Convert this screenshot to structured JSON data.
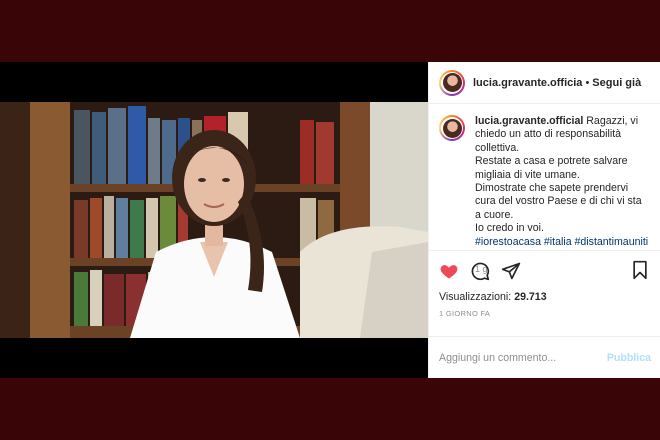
{
  "header": {
    "username": "lucia.gravante.officia",
    "separator": "•",
    "follow_status": "Segui già"
  },
  "caption": {
    "username": "lucia.gravante.official",
    "text_lines": [
      " Ragazzi, vi chiedo un atto di responsabilità collettiva.",
      "Restate a casa e potrete salvare migliaia di vite umane.",
      "Dimostrate che sapete prendervi cura del vostro Paese e di chi vi sta a cuore.",
      "Io credo in voi."
    ],
    "hashtags": "#iorestoacasa #italia #distantimauniti",
    "time": "1 g"
  },
  "actions": {
    "like_icon": "heart-filled-icon",
    "comment_icon": "speech-bubble-icon",
    "share_icon": "paper-plane-icon",
    "save_icon": "bookmark-icon",
    "like_color": "#ed4956"
  },
  "stats": {
    "views_label": "Visualizzazioni:",
    "views_count": "29.713",
    "date": "1 GIORNO FA"
  },
  "comment_box": {
    "placeholder": "Aggiungi un commento...",
    "publish_label": "Pubblica"
  }
}
